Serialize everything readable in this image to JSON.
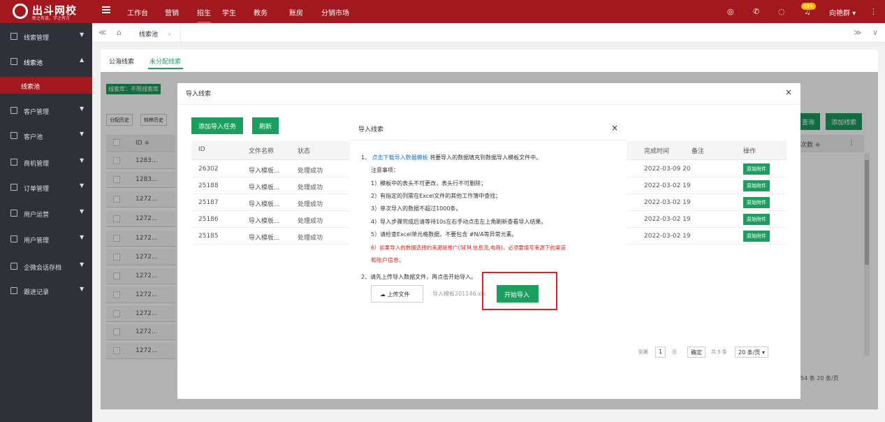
{
  "topbar": {
    "logo_title": "出斗网校",
    "logo_sub": "新之有道，学之有方",
    "nav": [
      "工作台",
      "营销",
      "招生",
      "学生",
      "教务",
      "账房",
      "分销市场"
    ],
    "active_nav": "招生",
    "badge": "99+",
    "user": "向艳群 ▾"
  },
  "sidebar": {
    "items": [
      {
        "label": "线索管理",
        "arrow": "▼"
      },
      {
        "label": "线索池",
        "arrow": "▲"
      },
      {
        "label": "客户管理",
        "arrow": "▼"
      },
      {
        "label": "客户池",
        "arrow": "▼"
      },
      {
        "label": "商机管理",
        "arrow": "▼"
      },
      {
        "label": "订单管理",
        "arrow": "▼"
      },
      {
        "label": "用户运营",
        "arrow": "▼"
      },
      {
        "label": "用户管理",
        "arrow": "▼"
      },
      {
        "label": "企微会话存档",
        "arrow": "▼"
      },
      {
        "label": "跟进记录",
        "arrow": "▼"
      }
    ],
    "active_sub": "线索池"
  },
  "tabbar": {
    "back": "≪",
    "home": "⌂",
    "page_tab": "线索池",
    "page_close": "×",
    "fwd": "≫",
    "more": "∨"
  },
  "main": {
    "subtabs": [
      "公海线索",
      "未分配线索"
    ],
    "active_subtab": "未分配线索",
    "tag": "线索库：不限线索库",
    "small_buttons": [
      "分配历史",
      "转移历史"
    ],
    "bg_header_id": "ID ≑",
    "bg_ids": [
      "1283...",
      "1283...",
      "1272...",
      "1272...",
      "1272...",
      "1272...",
      "1272...",
      "1272...",
      "1272...",
      "1272...",
      "1272..."
    ],
    "right_buttons": [
      "查询",
      "添加线索"
    ],
    "right_col_header": "次数 ≑",
    "right_pager": "54 条  20 条/页"
  },
  "outer_dialog": {
    "title": "导入线索",
    "close": "×",
    "buttons": [
      "添加导入任务",
      "刷新"
    ],
    "columns": [
      "ID",
      "文件名称",
      "状态",
      "完成时间",
      "备注",
      "操作"
    ],
    "rows": [
      {
        "id": "26302",
        "file": "导入模板...",
        "status": "处理成功",
        "time": "2022-03-09 20",
        "op": "原始附件"
      },
      {
        "id": "25188",
        "file": "导入模板...",
        "status": "处理成功",
        "time": "2022-03-02 19",
        "op": "原始附件"
      },
      {
        "id": "25187",
        "file": "导入模板...",
        "status": "处理成功",
        "time": "2022-03-02 19",
        "op": "原始附件"
      },
      {
        "id": "25186",
        "file": "导入模板...",
        "status": "处理成功",
        "time": "2022-03-02 19",
        "op": "原始附件"
      },
      {
        "id": "25185",
        "file": "导入模板...",
        "status": "处理成功",
        "time": "2022-03-02 19",
        "op": "原始附件"
      }
    ],
    "pager": {
      "goto": "到第",
      "page": "1",
      "unit": "页",
      "confirm": "确定",
      "total": "共 5 条",
      "size": "20 条/页 ▾"
    }
  },
  "inner_dialog": {
    "title": "导入线索",
    "close": "×",
    "step1_prefix": "1、",
    "step1_link": "点击下载导入数据模板",
    "step1_rest": "将要导入的数据填充到数据导入模板文件中。",
    "notes_title": "注意事项：",
    "notes": [
      "1）模板中的表头不可更改，表头行不可删除；",
      "2）有指定的列需在Excel文件的其他工作簿中查找；",
      "3）单次导入的数据不超过1000条。",
      "4）导入步骤完成后请等待10s左右手动点击左上角刷新查看导入结果。",
      "5）请检查Excel单元格数据，不要包含 #N/A等异常元素。"
    ],
    "warning1": "6）如果导入的数据选择的来源是推广(SEM,信息流,电商)，必须要填写来源下的渠道",
    "warning2": "和账户信息。",
    "step2": "2、请先上传导入数据文件，再点击开始导入。",
    "upload_button": "上传文件",
    "file_name": "导入模板201146.xls",
    "start_button": "开始导入"
  },
  "colors": {
    "brand": "#a3171e",
    "accent": "#1b9e5e",
    "sidebar": "#2e3238",
    "highlight": "#e02020"
  }
}
